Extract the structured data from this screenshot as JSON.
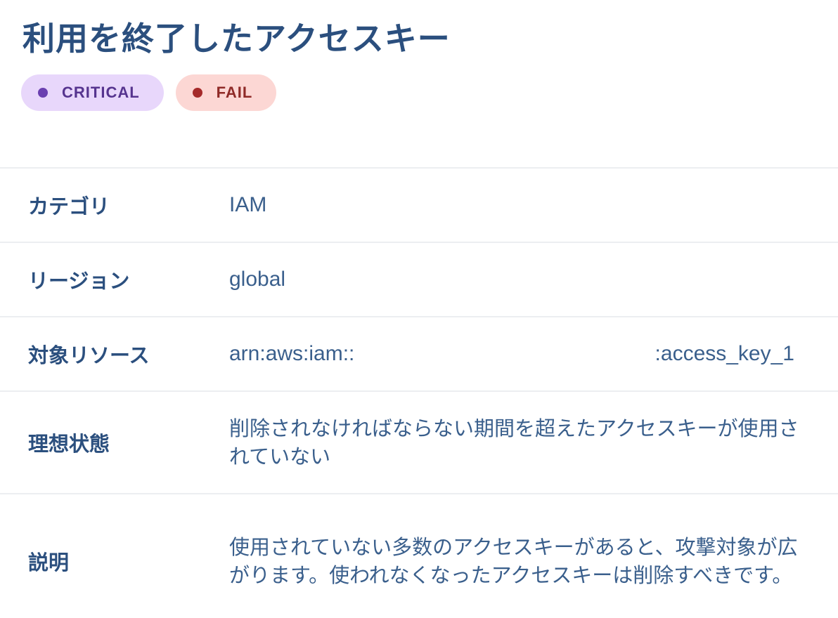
{
  "title": "利用を終了したアクセスキー",
  "badges": {
    "severity": {
      "label": "CRITICAL",
      "color": "#6a3fb0"
    },
    "status": {
      "label": "FAIL",
      "color": "#a52a2a"
    }
  },
  "details": {
    "category": {
      "label": "カテゴリ",
      "value": "IAM"
    },
    "region": {
      "label": "リージョン",
      "value": "global"
    },
    "resource": {
      "label": "対象リソース",
      "value_prefix": "arn:aws:iam::",
      "value_suffix": ":access_key_1"
    },
    "ideal_state": {
      "label": "理想状態",
      "value": "削除されなければならない期間を超えたアクセスキーが使用されていない"
    },
    "description": {
      "label": "説明",
      "value": "使用されていない多数のアクセスキーがあると、攻撃対象が広がります。使われなくなったアクセスキーは削除すべきです。"
    }
  }
}
